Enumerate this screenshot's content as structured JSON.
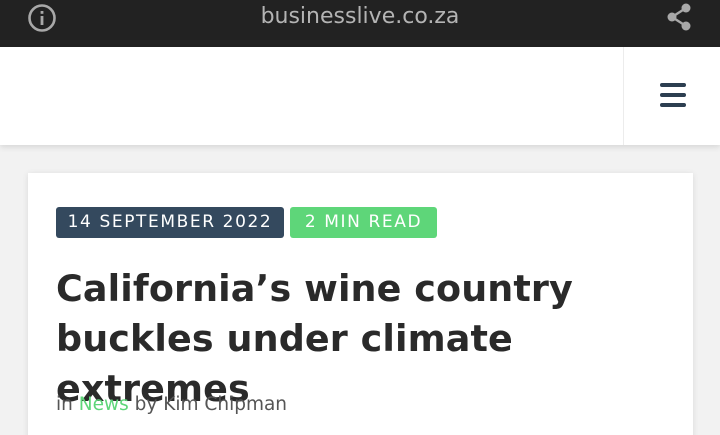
{
  "browser": {
    "domain": "businesslive.co.za",
    "info_icon": "info-circle-icon",
    "share_icon": "share-icon"
  },
  "header": {
    "menu_icon": "hamburger-menu-icon"
  },
  "article": {
    "date": "14 SEPTEMBER 2022",
    "read_time": "2 MIN READ",
    "title": "California’s wine country buckles under climate extremes",
    "byline": {
      "in_text": "in",
      "category": "News",
      "by_text": "by",
      "author": "Kim Chipman"
    }
  },
  "colors": {
    "topbar_bg": "#222222",
    "date_badge": "#34495e",
    "read_badge": "#5ed679",
    "category_link": "#5ed679"
  }
}
